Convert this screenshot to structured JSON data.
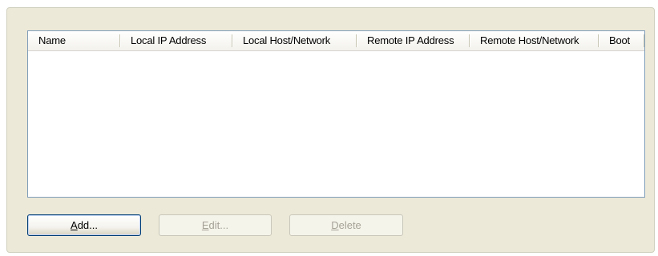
{
  "table": {
    "columns": [
      {
        "label": "Name"
      },
      {
        "label": "Local IP Address"
      },
      {
        "label": "Local Host/Network"
      },
      {
        "label": "Remote IP Address"
      },
      {
        "label": "Remote Host/Network"
      },
      {
        "label": "Boot"
      }
    ],
    "rows": []
  },
  "buttons": {
    "add": {
      "mnemonic": "A",
      "rest": "dd...",
      "enabled": true
    },
    "edit": {
      "mnemonic": "E",
      "rest": "dit...",
      "enabled": false
    },
    "delete": {
      "mnemonic": "D",
      "rest": "elete",
      "enabled": false
    }
  },
  "colors": {
    "panel_background": "#ece9d8",
    "list_border": "#7f9db9",
    "default_button_border": "#003c74",
    "disabled_text": "#a5a297"
  }
}
